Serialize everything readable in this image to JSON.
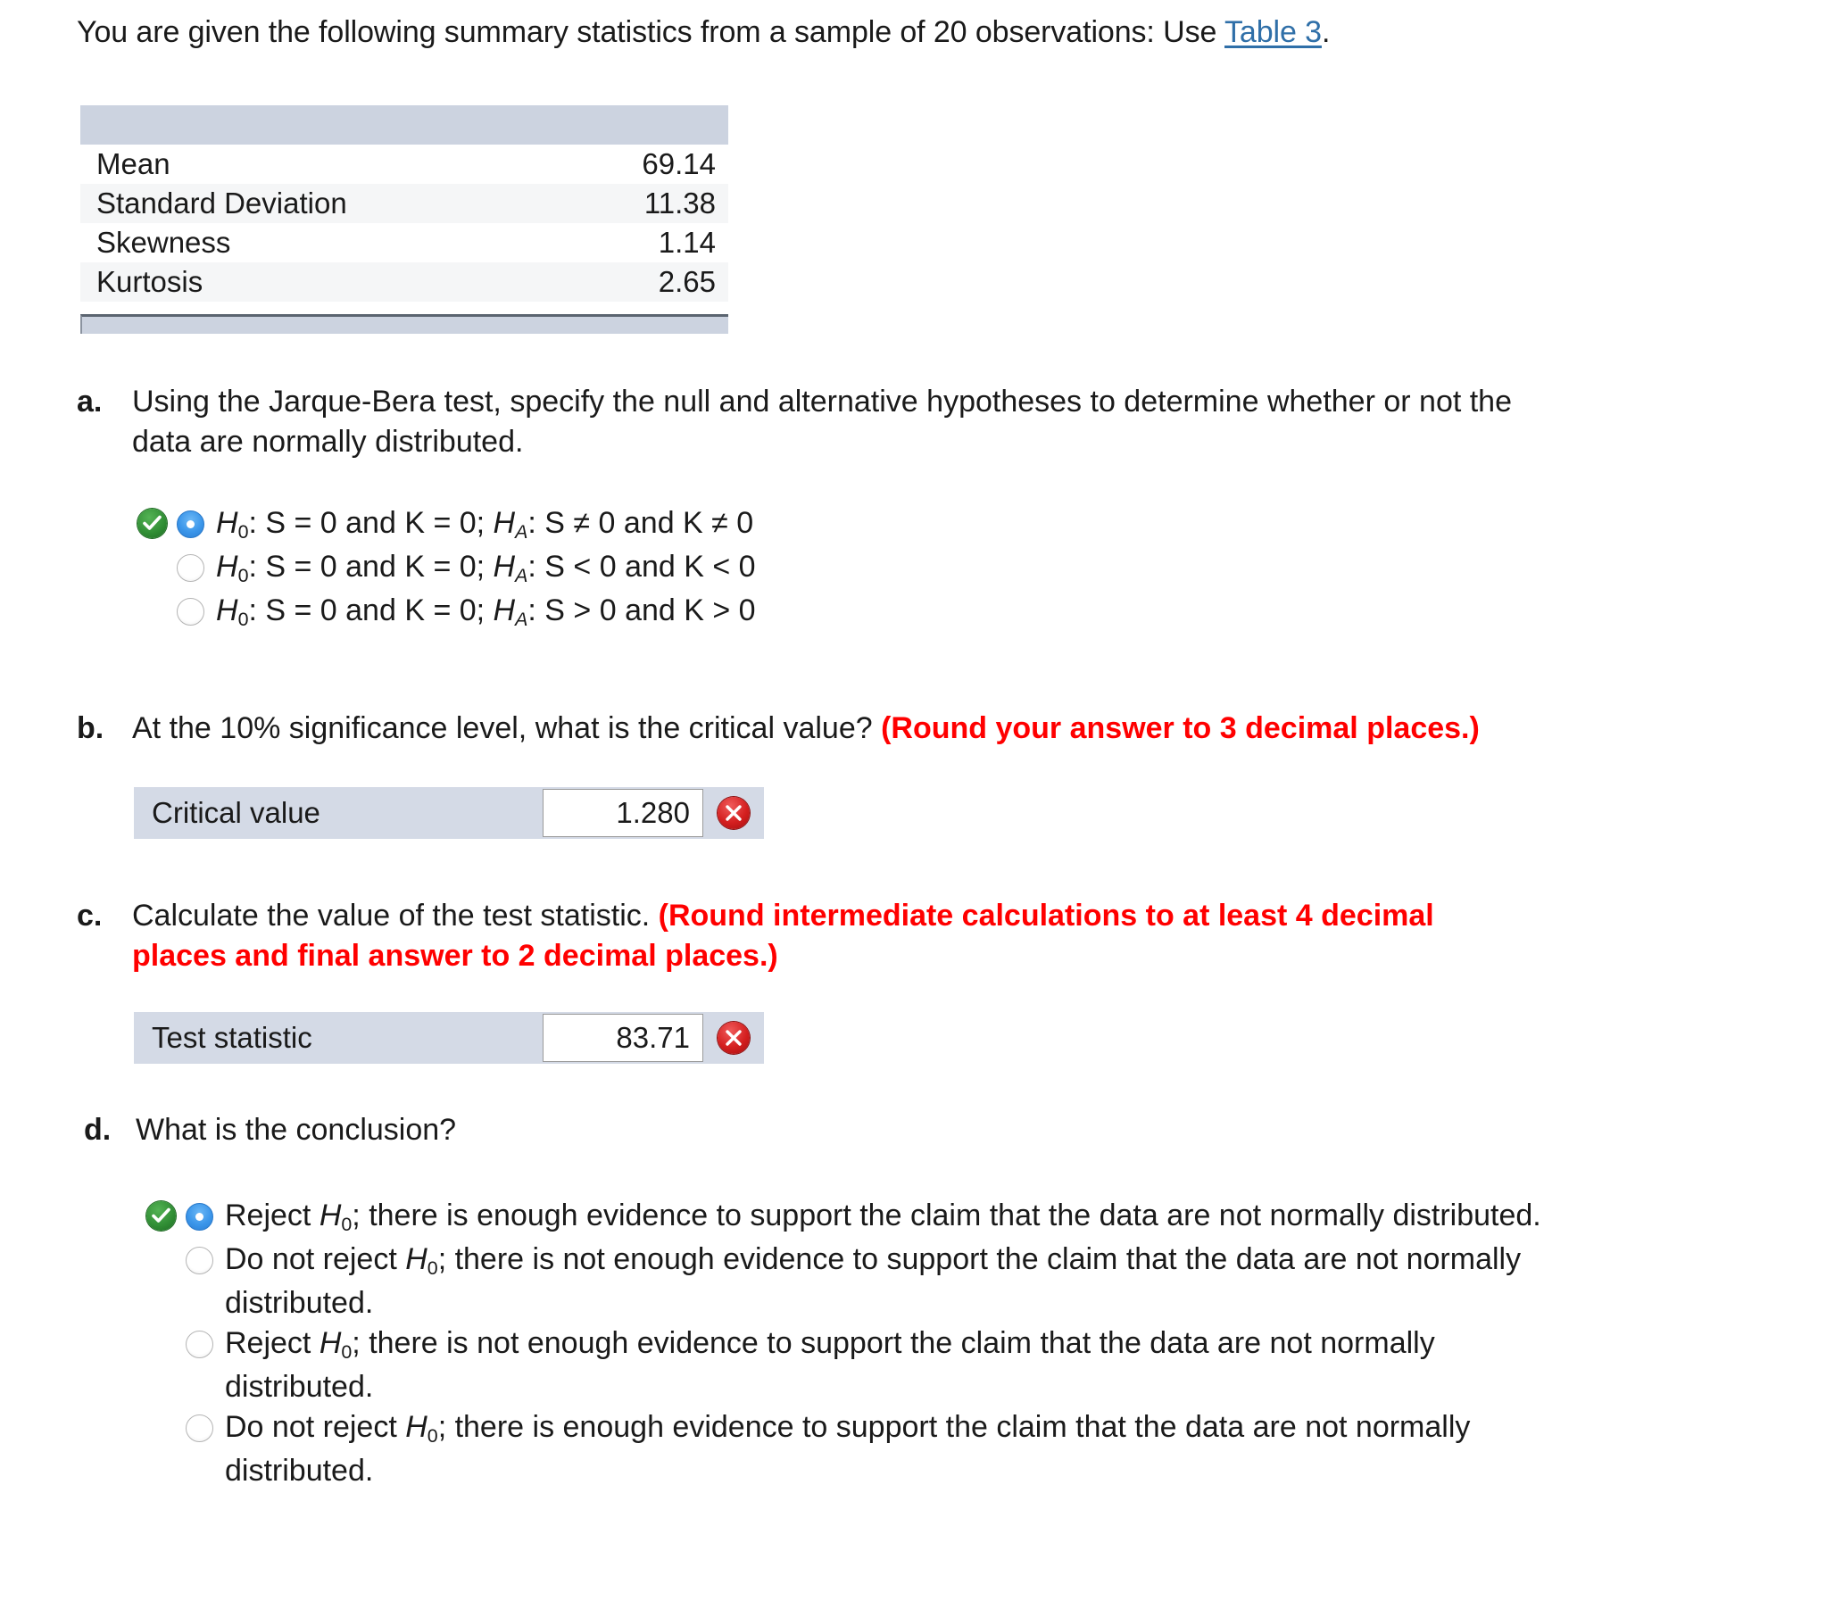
{
  "intro": {
    "before_link": "You are given the following summary statistics from a sample of 20 observations: Use ",
    "link_text": "Table 3",
    "after_link": "."
  },
  "stat_table": {
    "rows": [
      {
        "label": "Mean",
        "value": "69.14"
      },
      {
        "label": "Standard Deviation",
        "value": "11.38"
      },
      {
        "label": "Skewness",
        "value": "1.14"
      },
      {
        "label": "Kurtosis",
        "value": "2.65"
      }
    ],
    "header_fill": "#ccd3e0",
    "footer_fill": "#ccd3e0"
  },
  "questions": {
    "a": {
      "letter": "a.",
      "line1": "Using the Jarque-Bera test, specify the null and alternative hypotheses to determine whether or not the",
      "line2": "data are normally distributed.",
      "options": [
        {
          "null_part": ": S = 0 and K = 0; ",
          "alt_part": ": S ≠ 0 and K ≠ 0",
          "selected": true,
          "correct": true
        },
        {
          "null_part": ": S = 0 and K = 0; ",
          "alt_part": ": S < 0 and K < 0",
          "selected": false,
          "correct": false
        },
        {
          "null_part": ": S = 0 and K = 0; ",
          "alt_part": ": S > 0 and K > 0",
          "selected": false,
          "correct": false
        }
      ]
    },
    "b": {
      "letter": "b.",
      "text": "At the 10% significance level, what is the critical value? ",
      "note": "(Round your answer to 3 decimal places.)",
      "answer_label": "Critical value",
      "answer_value": "1.280",
      "answer_status": "incorrect"
    },
    "c": {
      "letter": "c.",
      "text": "Calculate the value of the test statistic. ",
      "note_line1": "(Round intermediate calculations to at least 4 decimal",
      "note_line2": "places and final answer to 2 decimal places.)",
      "answer_label": "Test statistic",
      "answer_value": "83.71",
      "answer_status": "incorrect"
    },
    "d": {
      "letter": "d.",
      "text": "What is the conclusion?",
      "options": [
        {
          "lines": [
            "Reject H|0|; there is enough evidence to support the claim that the data are not normally distributed."
          ],
          "selected": true,
          "correct": true
        },
        {
          "lines": [
            "Do not reject H|0|; there is not enough evidence to support the claim that the data are not normally",
            "distributed."
          ],
          "selected": false,
          "correct": false
        },
        {
          "lines": [
            "Reject H|0|; there is not enough evidence to support the claim that the data are not normally",
            "distributed."
          ],
          "selected": false,
          "correct": false
        },
        {
          "lines": [
            "Do not reject H|0|; there is enough evidence to support the claim that the data are not normally",
            "distributed."
          ],
          "selected": false,
          "correct": false
        }
      ]
    }
  },
  "colors": {
    "link": "#2f6fa8",
    "red_note": "#ff0000",
    "table_header": "#ccd3e0",
    "answer_row_bg": "#d4dae6",
    "correct_badge": "#2f8c33",
    "incorrect_badge": "#d41f1f"
  }
}
